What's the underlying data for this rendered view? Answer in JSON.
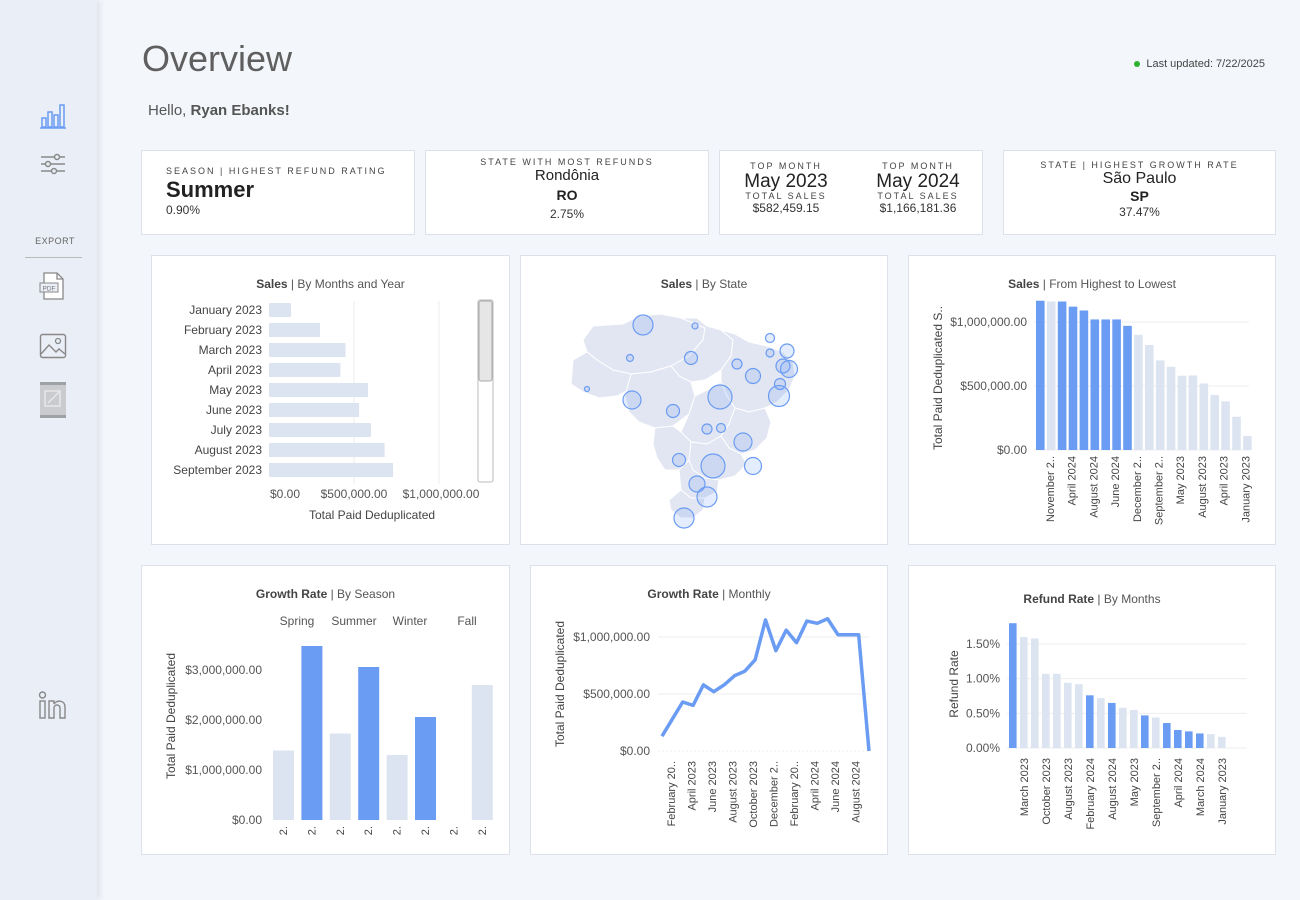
{
  "sidebar": {
    "export_label": "EXPORT",
    "icons": [
      "bar-chart-icon",
      "filter-sliders-icon",
      "pdf-icon",
      "image-icon",
      "crosstab-icon",
      "linkedin-icon"
    ]
  },
  "header": {
    "title": "Overview",
    "greeting_prefix": "Hello, ",
    "user_name": "Ryan Ebanks!",
    "last_updated": "Last updated: 7/22/2025",
    "status_color": "#2db32d"
  },
  "kpis": {
    "season": {
      "label": "SEASON | HIGHEST REFUND RATING",
      "value": "Summer",
      "sub": "0.90%"
    },
    "state_refunds": {
      "label": "STATE WITH MOST REFUNDS",
      "name": "Rondônia",
      "code": "RO",
      "sub": "2.75%"
    },
    "top_month_1": {
      "label": "TOP MONTH",
      "value": "May 2023",
      "sub_label": "TOTAL SALES",
      "sub": "$582,459.15"
    },
    "top_month_2": {
      "label": "TOP MONTH",
      "value": "May 2024",
      "sub_label": "TOTAL SALES",
      "sub": "$1,166,181.36"
    },
    "growth_state": {
      "label": "STATE | HIGHEST GROWTH RATE",
      "name": "São Paulo",
      "code": "SP",
      "sub": "37.47%"
    }
  },
  "colors": {
    "highlight": "#6b9cf3",
    "muted": "#dde4f1",
    "map_fill": "#e2e6f2",
    "map_stroke": "#ffffff"
  },
  "chart_data": [
    {
      "id": "sales-by-months",
      "type": "bar",
      "orientation": "horizontal",
      "title_bold": "Sales",
      "title_rest": " | By Months and Year",
      "categories": [
        "January 2023",
        "February 2023",
        "March 2023",
        "April 2023",
        "May 2023",
        "June 2023",
        "July 2023",
        "August 2023",
        "September 2023"
      ],
      "values": [
        130000,
        300000,
        450000,
        420000,
        582459.15,
        530000,
        600000,
        680000,
        730000
      ],
      "xlabel": "Total Paid Deduplicated",
      "xticks": [
        "$0.00",
        "$500,000.00",
        "$1,000,000.00"
      ],
      "xlim": [
        0,
        1000000
      ]
    },
    {
      "id": "sales-by-state",
      "type": "map",
      "title_bold": "Sales",
      "title_rest": " | By State"
    },
    {
      "id": "sales-high-low",
      "type": "bar",
      "title_bold": "Sales",
      "title_rest": " | From Highest to Lowest",
      "values": [
        1166181,
        1160000,
        1160000,
        1120000,
        1090000,
        1020000,
        1020000,
        1020000,
        970000,
        900000,
        820000,
        700000,
        650000,
        580000,
        582459,
        520000,
        430000,
        380000,
        260000,
        110000
      ],
      "highlight": [
        true,
        false,
        true,
        true,
        true,
        true,
        true,
        true,
        true,
        false,
        false,
        false,
        false,
        false,
        false,
        false,
        false,
        false,
        false,
        false
      ],
      "xticks": [
        "November 2..",
        "April 2024",
        "August 2024",
        "June 2024",
        "December 2..",
        "September 2..",
        "May 2023",
        "August 2023",
        "April 2023",
        "January 2023"
      ],
      "ylabel": "Total Paid Deduplicated S..",
      "yticks": [
        "$1,000,000.00",
        "$500,000.00",
        "$0.00"
      ],
      "ylim": [
        0,
        1250000
      ]
    },
    {
      "id": "growth-by-season",
      "type": "bar",
      "title_bold": "Growth Rate",
      "title_rest": " | By Season",
      "groups": [
        "Spring",
        "Summer",
        "Winter",
        "Fall"
      ],
      "values": [
        1390000,
        3480000,
        1730000,
        3060000,
        1300000,
        2060000,
        0,
        2700000
      ],
      "highlight": [
        false,
        true,
        false,
        true,
        false,
        true,
        false,
        false
      ],
      "xticks": [
        "2.",
        "2.",
        "2.",
        "2.",
        "2.",
        "2.",
        "2.",
        "2."
      ],
      "ylabel": "Total Paid Deduplicated",
      "yticks": [
        "$3,000,000.00",
        "$2,000,000.00",
        "$1,000,000.00",
        "$0.00"
      ],
      "ylim": [
        0,
        3000000
      ]
    },
    {
      "id": "growth-monthly",
      "type": "line",
      "title_bold": "Growth Rate",
      "title_rest": " | Monthly",
      "values": [
        130000,
        280000,
        430000,
        400000,
        580000,
        520000,
        580000,
        660000,
        700000,
        800000,
        1150000,
        880000,
        1060000,
        950000,
        1140000,
        1120000,
        1160000,
        1020000,
        1020000,
        1020000,
        0
      ],
      "xticks": [
        "February 20..",
        "April 2023",
        "June 2023",
        "August 2023",
        "October 2023",
        "December 2..",
        "February 20..",
        "April 2024",
        "June 2024",
        "August 2024"
      ],
      "ylabel": "Total Paid Deduplicated",
      "yticks": [
        "$1,000,000.00",
        "$500,000.00",
        "$0.00"
      ],
      "ylim": [
        0,
        1000000
      ]
    },
    {
      "id": "refund-by-months",
      "type": "bar",
      "title_bold": "Refund Rate",
      "title_rest": " | By Months",
      "values": [
        1.8,
        1.6,
        1.58,
        1.07,
        1.07,
        0.94,
        0.92,
        0.76,
        0.72,
        0.65,
        0.58,
        0.55,
        0.47,
        0.44,
        0.36,
        0.26,
        0.24,
        0.21,
        0.2,
        0.16
      ],
      "highlight": [
        true,
        false,
        false,
        false,
        false,
        false,
        false,
        true,
        false,
        true,
        false,
        false,
        true,
        false,
        true,
        true,
        true,
        true,
        false,
        false
      ],
      "xticks": [
        "March 2023",
        "October 2023",
        "August 2023",
        "February 2024",
        "August 2024",
        "May 2023",
        "September 2..",
        "April 2024",
        "March 2024",
        "January 2023"
      ],
      "ylabel": "Refund Rate",
      "yticks": [
        "1.50%",
        "1.00%",
        "0.50%",
        "0.00%"
      ],
      "ylim": [
        0,
        1.5
      ]
    }
  ]
}
